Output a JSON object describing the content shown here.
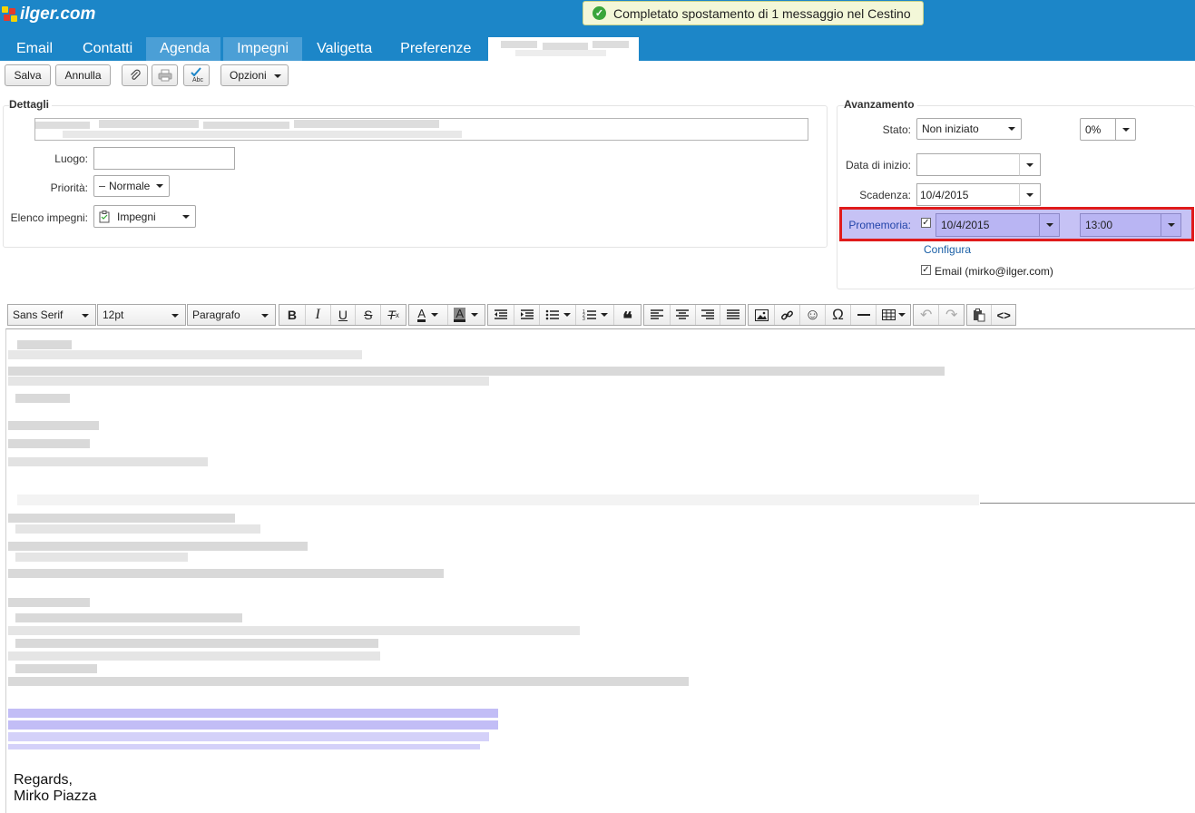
{
  "header": {
    "logo_text": "ilger.com",
    "notification": "Completato spostamento di 1 messaggio nel Cestino",
    "tabs": [
      {
        "label": "Email"
      },
      {
        "label": "Contatti"
      },
      {
        "label": "Agenda"
      },
      {
        "label": "Impegni"
      },
      {
        "label": "Valigetta"
      },
      {
        "label": "Preferenze"
      }
    ],
    "accent_color": "#1c86c8"
  },
  "toolbar": {
    "save_label": "Salva",
    "cancel_label": "Annulla",
    "options_label": "Opzioni"
  },
  "details": {
    "legend": "Dettagli",
    "location_label": "Luogo:",
    "location_value": "",
    "priority_label": "Priorità:",
    "priority_value": "Normale",
    "tasklist_label": "Elenco impegni:",
    "tasklist_value": "Impegni"
  },
  "progress": {
    "legend": "Avanzamento",
    "status_label": "Stato:",
    "status_value": "Non iniziato",
    "percent_value": "0%",
    "start_label": "Data di inizio:",
    "start_value": "",
    "due_label": "Scadenza:",
    "due_value": "10/4/2015",
    "reminder_label": "Promemoria:",
    "reminder_checked": true,
    "reminder_date": "10/4/2015",
    "reminder_time": "13:00",
    "configure_link": "Configura",
    "email_checked": true,
    "email_label": "Email (mirko@ilger.com)"
  },
  "editor": {
    "font_family": "Sans Serif",
    "font_size": "12pt",
    "block_format": "Paragrafo",
    "signature_lines": [
      "Regards,",
      "Mirko Piazza"
    ]
  }
}
